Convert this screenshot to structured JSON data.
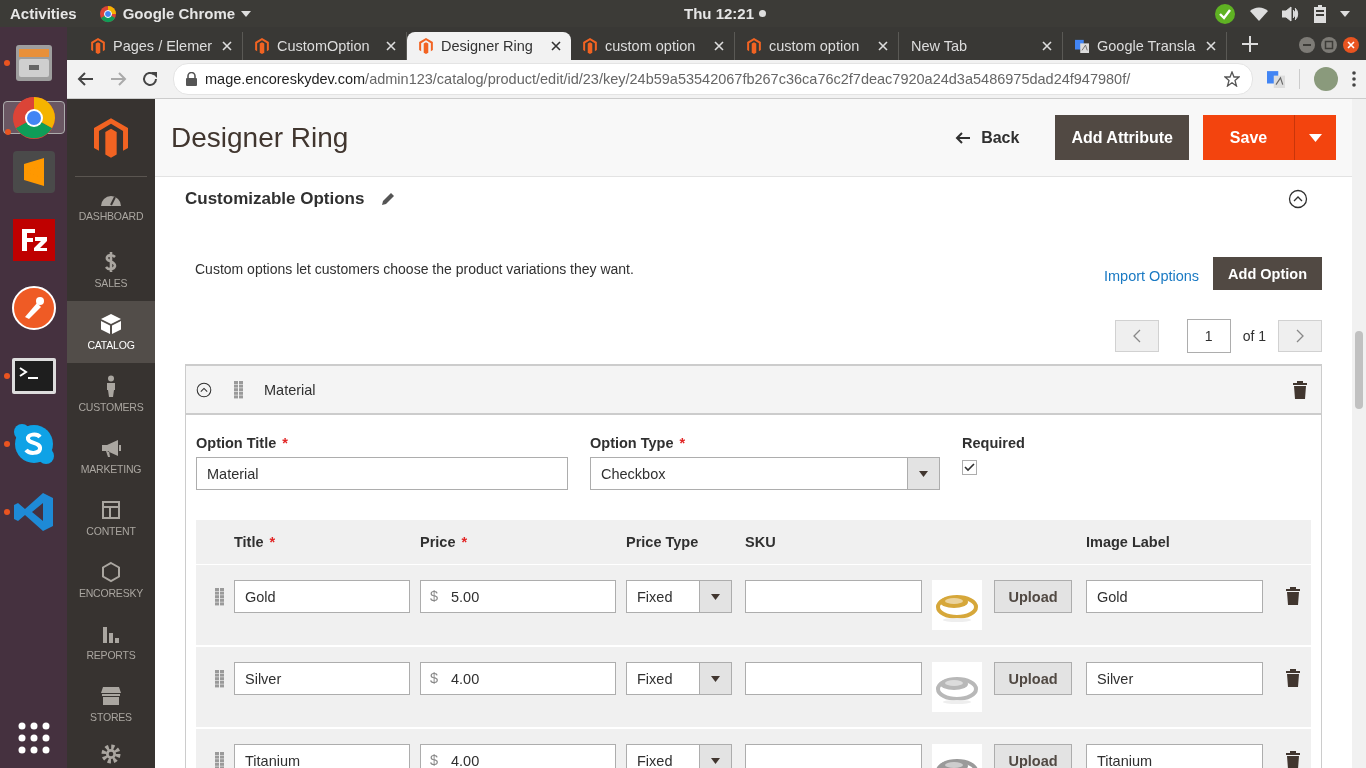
{
  "top_bar": {
    "activities": "Activities",
    "app_name": "Google Chrome",
    "clock": "Thu 12:21"
  },
  "dock": [
    {
      "running": true,
      "selected": false
    },
    {
      "running": true,
      "selected": true
    },
    {
      "running": false,
      "selected": false
    },
    {
      "running": false,
      "selected": false
    },
    {
      "running": false,
      "selected": false
    },
    {
      "running": true,
      "selected": false
    },
    {
      "running": true,
      "selected": false
    },
    {
      "running": true,
      "selected": false
    }
  ],
  "browser": {
    "tabs": [
      {
        "title": "Pages / Elemer",
        "selected": false
      },
      {
        "title": "CustomOption",
        "selected": false
      },
      {
        "title": "Designer Ring",
        "selected": true
      },
      {
        "title": "custom option",
        "selected": false
      },
      {
        "title": "custom option",
        "selected": false
      },
      {
        "title": "New Tab",
        "selected": false
      },
      {
        "title": "Google Transla",
        "selected": false
      }
    ],
    "url_host": "mage.encoreskydev.com",
    "url_path": "/admin123/catalog/product/edit/id/23/key/24b59a53542067fb267c36ca76c2f7deac7920a24d3a5486975dad24f947980f/"
  },
  "admin_menu": [
    {
      "label": "DASHBOARD",
      "selected": false
    },
    {
      "label": "SALES",
      "selected": false
    },
    {
      "label": "CATALOG",
      "selected": true
    },
    {
      "label": "CUSTOMERS",
      "selected": false
    },
    {
      "label": "MARKETING",
      "selected": false
    },
    {
      "label": "CONTENT",
      "selected": false
    },
    {
      "label": "ENCORESKY",
      "selected": false
    },
    {
      "label": "REPORTS",
      "selected": false
    },
    {
      "label": "STORES",
      "selected": false
    }
  ],
  "page": {
    "title": "Designer Ring",
    "back": "Back",
    "add_attribute": "Add Attribute",
    "save": "Save"
  },
  "section": {
    "title": "Customizable Options",
    "expanded": true,
    "description": "Custom options let customers choose the product variations they want.",
    "import_link": "Import Options",
    "add_option": "Add Option",
    "pagination": {
      "page": "1",
      "of": "of 1"
    }
  },
  "option": {
    "title": "Material",
    "expanded": true,
    "fields": [
      {
        "label": "Option Title",
        "required_mark": "*",
        "kind": "text",
        "value": "Material"
      },
      {
        "label": "Option Type",
        "required_mark": "*",
        "kind": "select",
        "value": "Checkbox"
      },
      {
        "label": "Required",
        "kind": "checkbox",
        "checked": true
      }
    ],
    "columns": [
      {
        "label": "Title",
        "required_mark": "*"
      },
      {
        "label": "Price",
        "required_mark": "*"
      },
      {
        "label": "Price Type"
      },
      {
        "label": "SKU"
      },
      {
        "label": "Image Label"
      }
    ],
    "rows": [
      {
        "title": "Gold",
        "currency": "$",
        "price": "5.00",
        "price_type": "Fixed",
        "upload": "Upload",
        "image_label": "Gold"
      },
      {
        "title": "Silver",
        "currency": "$",
        "price": "4.00",
        "price_type": "Fixed",
        "upload": "Upload",
        "image_label": "Silver"
      },
      {
        "title": "Titanium",
        "currency": "$",
        "price": "4.00",
        "price_type": "Fixed",
        "upload": "Upload",
        "image_label": "Titanium"
      }
    ]
  }
}
